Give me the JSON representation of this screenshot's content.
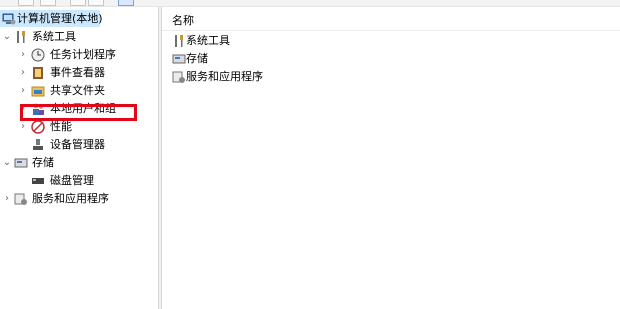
{
  "tree": {
    "root": {
      "label": "计算机管理(本地)",
      "icon": "computer-management-icon"
    },
    "system_tools": {
      "label": "系统工具",
      "icon": "tools-icon"
    },
    "task_scheduler": {
      "label": "任务计划程序",
      "icon": "clock-icon"
    },
    "event_viewer": {
      "label": "事件查看器",
      "icon": "event-viewer-icon"
    },
    "shared_folders": {
      "label": "共享文件夹",
      "icon": "shared-folder-icon"
    },
    "local_users": {
      "label": "本地用户和组",
      "icon": "users-icon"
    },
    "performance": {
      "label": "性能",
      "icon": "performance-icon"
    },
    "device_manager": {
      "label": "设备管理器",
      "icon": "device-manager-icon"
    },
    "storage": {
      "label": "存储",
      "icon": "storage-icon"
    },
    "disk_management": {
      "label": "磁盘管理",
      "icon": "disk-icon"
    },
    "services_apps": {
      "label": "服务和应用程序",
      "icon": "services-icon"
    }
  },
  "content": {
    "column_header": "名称",
    "items": [
      {
        "label": "系统工具",
        "icon": "tools-icon"
      },
      {
        "label": "存储",
        "icon": "storage-icon"
      },
      {
        "label": "服务和应用程序",
        "icon": "services-icon"
      }
    ]
  },
  "colors": {
    "highlight": "#e3061b",
    "selection": "#cce8ff"
  }
}
